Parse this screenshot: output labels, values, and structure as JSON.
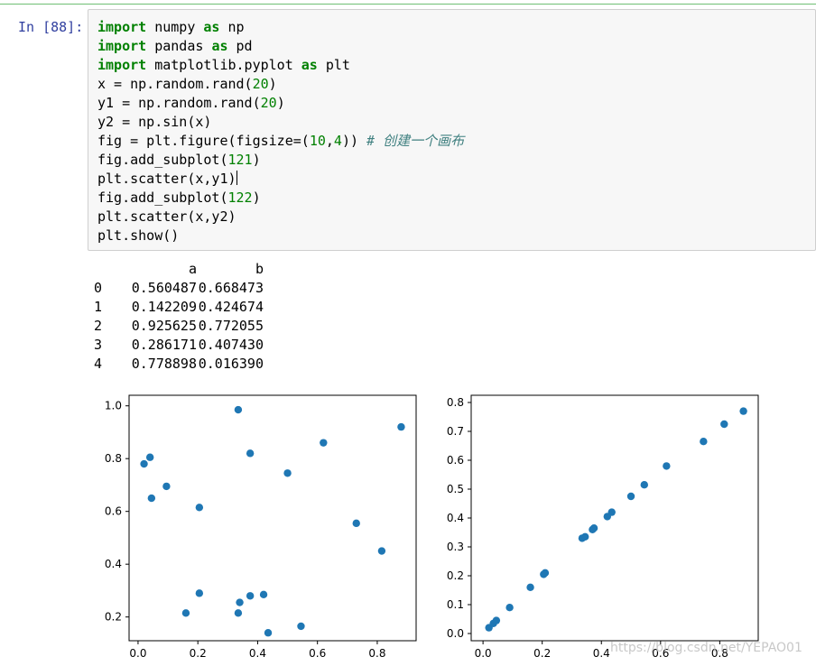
{
  "notebook": {
    "prompt": "In [88]:",
    "code_lines": [
      [
        {
          "t": "import",
          "c": "kw"
        },
        {
          "t": " numpy "
        },
        {
          "t": "as",
          "c": "kw"
        },
        {
          "t": " np"
        }
      ],
      [
        {
          "t": "import",
          "c": "kw"
        },
        {
          "t": " pandas "
        },
        {
          "t": "as",
          "c": "kw"
        },
        {
          "t": " pd"
        }
      ],
      [
        {
          "t": "import",
          "c": "kw"
        },
        {
          "t": " matplotlib.pyplot "
        },
        {
          "t": "as",
          "c": "kw"
        },
        {
          "t": " plt"
        }
      ],
      [
        {
          "t": "x = np.random.rand("
        },
        {
          "t": "20",
          "c": "num"
        },
        {
          "t": ")"
        }
      ],
      [
        {
          "t": "y1 = np.random.rand("
        },
        {
          "t": "20",
          "c": "num"
        },
        {
          "t": ")"
        }
      ],
      [
        {
          "t": "y2 = np.sin(x)"
        }
      ],
      [
        {
          "t": "fig = plt.figure(figsize=("
        },
        {
          "t": "10",
          "c": "num"
        },
        {
          "t": ","
        },
        {
          "t": "4",
          "c": "num"
        },
        {
          "t": ")) "
        },
        {
          "t": "# 创建一个画布",
          "c": "cm"
        }
      ],
      [
        {
          "t": "fig.add_subplot("
        },
        {
          "t": "121",
          "c": "num"
        },
        {
          "t": ")"
        }
      ],
      [
        {
          "t": "plt.scatter(x,y1)"
        },
        {
          "t": "",
          "c": "cursor"
        }
      ],
      [
        {
          "t": "fig.add_subplot("
        },
        {
          "t": "122",
          "c": "num"
        },
        {
          "t": ")"
        }
      ],
      [
        {
          "t": "plt.scatter(x,y2)"
        }
      ],
      [
        {
          "t": "plt.show()"
        }
      ]
    ]
  },
  "dataframe": {
    "columns": [
      "a",
      "b"
    ],
    "rows": [
      {
        "index": "0",
        "a": "0.560487",
        "b": "0.668473"
      },
      {
        "index": "1",
        "a": "0.142209",
        "b": "0.424674"
      },
      {
        "index": "2",
        "a": "0.925625",
        "b": "0.772055"
      },
      {
        "index": "3",
        "a": "0.286171",
        "b": "0.407430"
      },
      {
        "index": "4",
        "a": "0.778898",
        "b": "0.016390"
      }
    ]
  },
  "watermark": "https://blog.csdn.net/YEPAO01",
  "chart_data": [
    {
      "type": "scatter",
      "color": "#1f77b4",
      "xlim": [
        -0.03,
        0.93
      ],
      "ylim": [
        0.11,
        1.04
      ],
      "xticks": [
        "0.0",
        "0.2",
        "0.4",
        "0.6",
        "0.8"
      ],
      "yticks": [
        "0.2",
        "0.4",
        "0.6",
        "0.8",
        "1.0"
      ],
      "points": [
        [
          0.02,
          0.78
        ],
        [
          0.04,
          0.805
        ],
        [
          0.045,
          0.65
        ],
        [
          0.095,
          0.695
        ],
        [
          0.16,
          0.215
        ],
        [
          0.205,
          0.615
        ],
        [
          0.205,
          0.29
        ],
        [
          0.335,
          0.985
        ],
        [
          0.335,
          0.215
        ],
        [
          0.34,
          0.255
        ],
        [
          0.375,
          0.82
        ],
        [
          0.375,
          0.28
        ],
        [
          0.42,
          0.285
        ],
        [
          0.435,
          0.14
        ],
        [
          0.5,
          0.745
        ],
        [
          0.545,
          0.165
        ],
        [
          0.62,
          0.86
        ],
        [
          0.73,
          0.555
        ],
        [
          0.815,
          0.45
        ],
        [
          0.88,
          0.92
        ]
      ]
    },
    {
      "type": "scatter",
      "color": "#1f77b4",
      "xlim": [
        -0.04,
        0.93
      ],
      "ylim": [
        -0.025,
        0.825
      ],
      "xticks": [
        "0.0",
        "0.2",
        "0.4",
        "0.6",
        "0.8"
      ],
      "yticks": [
        "0.0",
        "0.1",
        "0.2",
        "0.3",
        "0.4",
        "0.5",
        "0.6",
        "0.7",
        "0.8"
      ],
      "points": [
        [
          0.02,
          0.02
        ],
        [
          0.035,
          0.035
        ],
        [
          0.045,
          0.045
        ],
        [
          0.09,
          0.09
        ],
        [
          0.16,
          0.16
        ],
        [
          0.205,
          0.205
        ],
        [
          0.21,
          0.21
        ],
        [
          0.335,
          0.33
        ],
        [
          0.345,
          0.335
        ],
        [
          0.37,
          0.36
        ],
        [
          0.375,
          0.365
        ],
        [
          0.42,
          0.405
        ],
        [
          0.435,
          0.42
        ],
        [
          0.5,
          0.475
        ],
        [
          0.545,
          0.515
        ],
        [
          0.62,
          0.58
        ],
        [
          0.745,
          0.665
        ],
        [
          0.815,
          0.725
        ],
        [
          0.88,
          0.77
        ]
      ]
    }
  ]
}
